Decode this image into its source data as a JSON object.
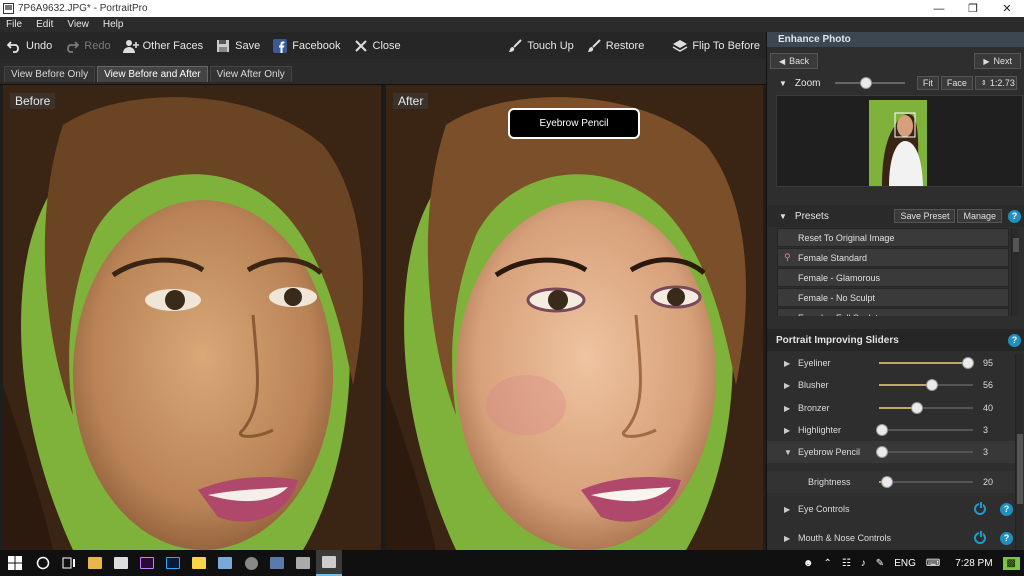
{
  "window": {
    "title": "7P6A9632.JPG* - PortraitPro"
  },
  "menu": [
    "File",
    "Edit",
    "View",
    "Help"
  ],
  "toolbar": {
    "undo": "Undo",
    "redo": "Redo",
    "other_faces": "Other Faces",
    "save": "Save",
    "facebook": "Facebook",
    "close": "Close",
    "touch_up": "Touch Up",
    "restore": "Restore",
    "flip": "Flip To Before"
  },
  "view_tabs": [
    "View Before Only",
    "View Before and After",
    "View After Only"
  ],
  "panes": {
    "before_label": "Before",
    "after_label": "After"
  },
  "tooltip": "Eyebrow Pencil",
  "right_panel": {
    "header": "Enhance Photo",
    "back": "Back",
    "next": "Next",
    "zoom_label": "Zoom",
    "fit": "Fit",
    "face": "Face",
    "zoom_value": "1:2.73",
    "zoom_level": 0.45,
    "presets_label": "Presets",
    "save_preset": "Save Preset",
    "manage": "Manage",
    "presets": [
      "Reset To Original Image",
      "Female Standard",
      "Female - Glamorous",
      "Female - No Sculpt",
      "Female - Full Sculpt"
    ],
    "sliders_header": "Portrait Improving Sliders",
    "sliders": [
      {
        "name": "Eyeliner",
        "value": "95",
        "level": 0.95
      },
      {
        "name": "Blusher",
        "value": "56",
        "level": 0.56
      },
      {
        "name": "Bronzer",
        "value": "40",
        "level": 0.4
      },
      {
        "name": "Highlighter",
        "value": "3",
        "level": 0.03
      },
      {
        "name": "Eyebrow Pencil",
        "value": "3",
        "level": 0.03
      }
    ],
    "brightness": {
      "name": "Brightness",
      "value": "20",
      "level": 0.08
    },
    "eye_controls": "Eye Controls",
    "mouth_nose": "Mouth & Nose Controls"
  },
  "taskbar": {
    "lang": "ENG",
    "time": "7:28 PM"
  },
  "colors": {
    "accent": "#1e8fbf",
    "slider_fill": "#bda86a",
    "header": "#3c4752"
  }
}
